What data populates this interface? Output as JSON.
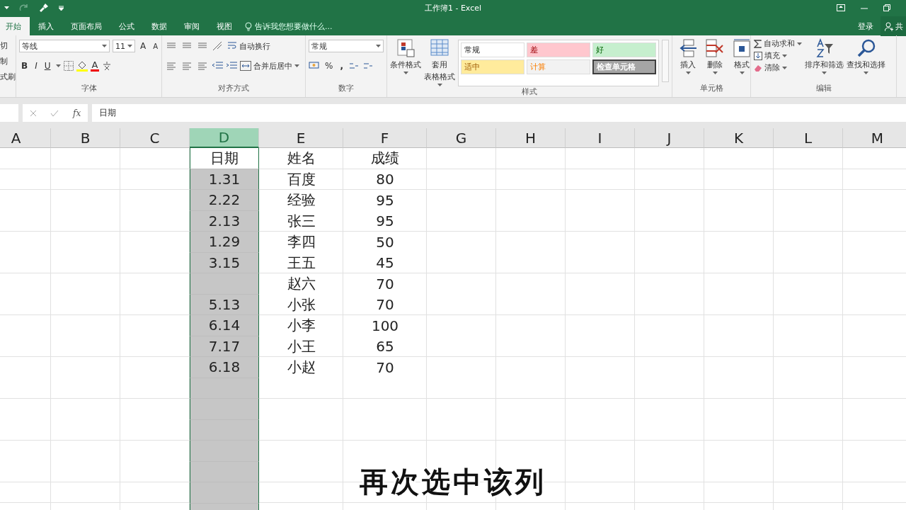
{
  "window": {
    "title": "工作簿1 - Excel"
  },
  "account": {
    "sign_in": "登录",
    "share": "共"
  },
  "tabs": [
    {
      "label": "开始",
      "selected": true
    },
    {
      "label": "插入",
      "selected": false
    },
    {
      "label": "页面布局",
      "selected": false
    },
    {
      "label": "公式",
      "selected": false
    },
    {
      "label": "数据",
      "selected": false
    },
    {
      "label": "审阅",
      "selected": false
    },
    {
      "label": "视图",
      "selected": false
    }
  ],
  "tell_me": {
    "placeholder": "告诉我您想要做什么..."
  },
  "ribbon": {
    "clipboard": [
      "切",
      "制",
      "式刷"
    ],
    "font": {
      "label": "字体",
      "family": "等线",
      "size": "11",
      "grow": "A",
      "shrink": "A",
      "bold": "B",
      "italic": "I",
      "underline": "U",
      "text_color_button": "A"
    },
    "alignment": {
      "label": "对齐方式",
      "wrap": "自动换行",
      "merge": "合并后居中"
    },
    "number": {
      "label": "数字",
      "format": "常规",
      "percent": "%",
      "comma": ","
    },
    "styles": {
      "label": "样式",
      "conditional": "条件格式",
      "table": [
        "套用",
        "表格格式"
      ],
      "gallery": [
        {
          "label": "常规",
          "color": "#ffffff"
        },
        {
          "label": "差",
          "color": "#ffc7ce"
        },
        {
          "label": "好",
          "color": "#c6efce"
        },
        {
          "label": "适中",
          "color": "#ffeb9c"
        },
        {
          "label": "计算",
          "color": "#f2f2f2"
        },
        {
          "label": "检查单元格",
          "color": "#a5a5a5"
        }
      ]
    },
    "cells": {
      "label": "单元格",
      "buttons": [
        {
          "kind": "insert",
          "label": "插入"
        },
        {
          "kind": "delete",
          "label": "删除"
        },
        {
          "kind": "format",
          "label": "格式"
        }
      ]
    },
    "editing": {
      "label": "编辑",
      "autosum": "自动求和",
      "fill": "填充",
      "clear": "清除",
      "sort": "排序和筛选",
      "find": "查找和选择"
    }
  },
  "formula_bar": {
    "fx": "fx",
    "value": "日期"
  },
  "sheet": {
    "columns": [
      {
        "label": "A",
        "selected": false
      },
      {
        "label": "B",
        "selected": false
      },
      {
        "label": "C",
        "selected": false
      },
      {
        "label": "D",
        "selected": true
      },
      {
        "label": "E",
        "selected": false
      },
      {
        "label": "F",
        "selected": false
      },
      {
        "label": "G",
        "selected": false
      },
      {
        "label": "H",
        "selected": false
      },
      {
        "label": "I",
        "selected": false
      },
      {
        "label": "J",
        "selected": false
      },
      {
        "label": "K",
        "selected": false
      },
      {
        "label": "L",
        "selected": false
      },
      {
        "label": "M",
        "selected": false
      }
    ],
    "rows": [
      {
        "active": true,
        "D": "日期",
        "E": "姓名",
        "F": "成绩"
      },
      {
        "active": false,
        "D": "1.31",
        "E": "百度",
        "F": "80"
      },
      {
        "active": false,
        "D": "2.22",
        "E": "经验",
        "F": "95"
      },
      {
        "active": false,
        "D": "2.13",
        "E": "张三",
        "F": "95"
      },
      {
        "active": false,
        "D": "1.29",
        "E": "李四",
        "F": "50"
      },
      {
        "active": false,
        "D": "3.15",
        "E": "王五",
        "F": "45"
      },
      {
        "active": false,
        "E": "赵六",
        "F": "70"
      },
      {
        "active": false,
        "D": "5.13",
        "E": "小张",
        "F": "70"
      },
      {
        "active": false,
        "D": "6.14",
        "E": "小李",
        "F": "100"
      },
      {
        "active": false,
        "D": "7.17",
        "E": "小王",
        "F": "65"
      },
      {
        "active": false,
        "D": "6.18",
        "E": "小赵",
        "F": "70"
      }
    ]
  },
  "caption": "再次选中该列"
}
